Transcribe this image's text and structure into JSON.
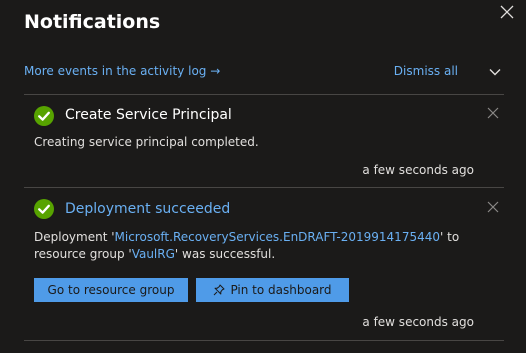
{
  "panel": {
    "title": "Notifications",
    "activity_link": "More events in the activity log →",
    "dismiss_all": "Dismiss all"
  },
  "notifications": [
    {
      "status": "success",
      "title": "Create Service Principal",
      "message": "Creating service principal completed.",
      "time": "a few seconds ago"
    },
    {
      "status": "success",
      "title": "Deployment succeeded",
      "message": {
        "prefix": "Deployment '",
        "deployment_name": "Microsoft.RecoveryServices.EnDRAFT-2019914175440",
        "middle_1": "' to",
        "middle_2": "resource group '",
        "resource_group": "VaulRG",
        "suffix": "' was successful."
      },
      "actions": {
        "go_to_resource_group": "Go to resource group",
        "pin_to_dashboard": "Pin to dashboard"
      },
      "time": "a few seconds ago"
    }
  ],
  "colors": {
    "background": "#1b1a19",
    "link": "#6ab0f3",
    "success": "#57a300",
    "button": "#4f9be8",
    "divider": "#484644"
  },
  "icons": {
    "close": "close-icon",
    "chevron": "chevron-down-icon",
    "success": "checkmark-circle-icon",
    "pin": "pin-icon"
  }
}
